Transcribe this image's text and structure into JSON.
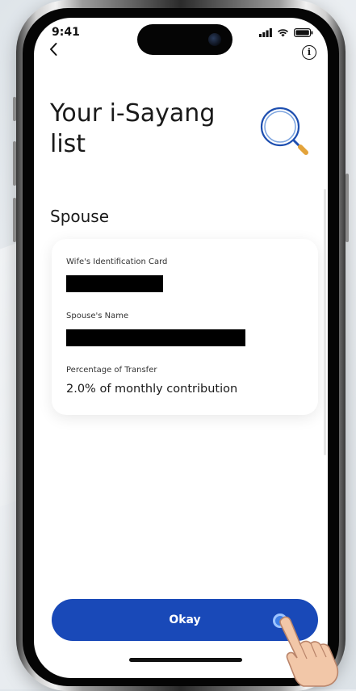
{
  "status_bar": {
    "time": "9:41"
  },
  "header": {
    "back_icon": "chevron-left-icon",
    "info_icon": "info-icon"
  },
  "page": {
    "title": "Your i-Sayang list",
    "illustration_icon": "search-magnifier-icon"
  },
  "section": {
    "title": "Spouse"
  },
  "card": {
    "fields": [
      {
        "label": "Wife's Identification Card",
        "value_redacted": true
      },
      {
        "label": "Spouse's Name",
        "value_redacted": true
      },
      {
        "label": "Percentage of Transfer",
        "value": "2.0% of monthly contribution"
      }
    ]
  },
  "actions": {
    "okay_label": "Okay"
  },
  "colors": {
    "primary": "#1949b8",
    "background": "#ffffff",
    "text": "#1a1a1a",
    "redaction": "#000000"
  }
}
